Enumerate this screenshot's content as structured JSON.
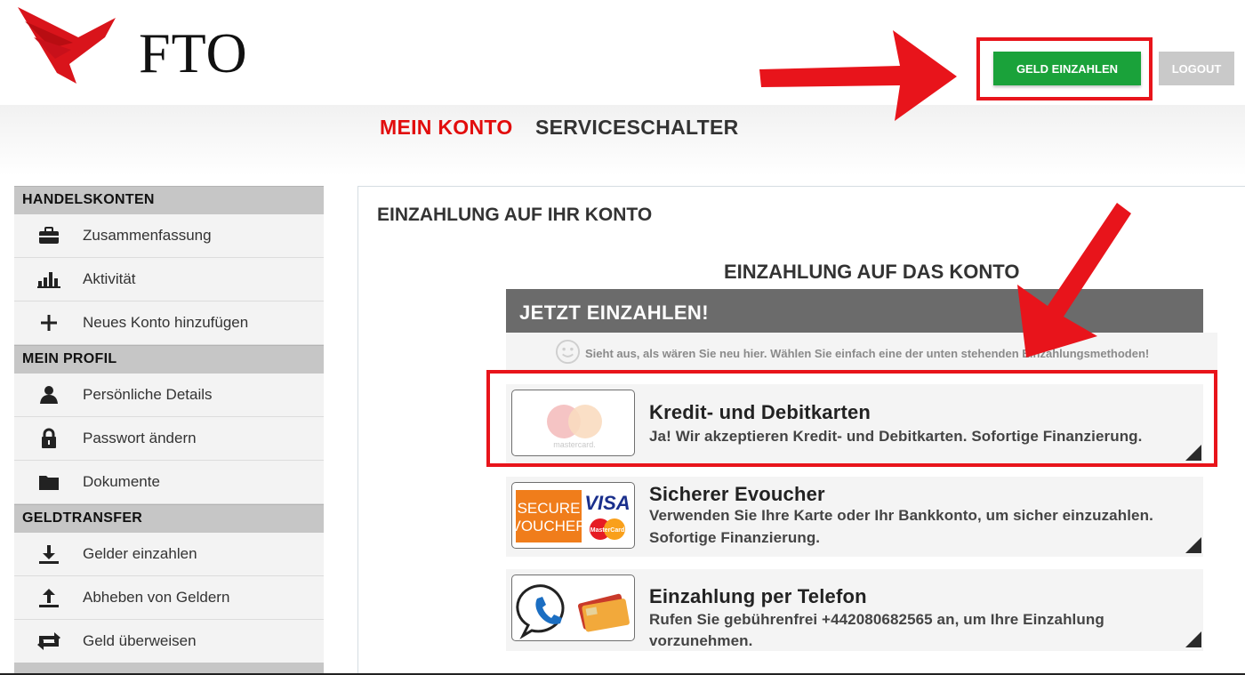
{
  "header": {
    "logo_text": "FTO",
    "deposit_button": "GELD EINZAHLEN",
    "logout_button": "LOGOUT"
  },
  "nav": {
    "items": [
      {
        "label": "MEIN KONTO",
        "active": true
      },
      {
        "label": "SERVICESCHALTER",
        "active": false
      }
    ]
  },
  "sidebar": {
    "sections": [
      {
        "title": "HANDELSKONTEN",
        "items": [
          {
            "label": "Zusammenfassung",
            "icon": "briefcase-icon"
          },
          {
            "label": "Aktivität",
            "icon": "bar-chart-icon"
          },
          {
            "label": "Neues Konto hinzufügen",
            "icon": "plus-icon"
          }
        ]
      },
      {
        "title": "MEIN PROFIL",
        "items": [
          {
            "label": "Persönliche Details",
            "icon": "user-icon"
          },
          {
            "label": "Passwort ändern",
            "icon": "lock-icon"
          },
          {
            "label": "Dokumente",
            "icon": "folder-icon"
          }
        ]
      },
      {
        "title": "GELDTRANSFER",
        "items": [
          {
            "label": "Gelder einzahlen",
            "icon": "download-icon"
          },
          {
            "label": "Abheben von Geldern",
            "icon": "upload-icon"
          },
          {
            "label": "Geld überweisen",
            "icon": "transfer-icon"
          }
        ]
      }
    ]
  },
  "main": {
    "title": "EINZAHLUNG AUF IHR KONTO",
    "subtitle": "EINZAHLUNG AUF DAS KONTO",
    "banner": "JETZT EINZAHLEN!",
    "hint": "Sieht aus, als wären Sie neu hier. Wählen Sie einfach eine der unten stehenden Einzahlungsmethoden!",
    "methods": [
      {
        "title": "Kredit- und Debitkarten",
        "desc": [
          "Ja! Wir akzeptieren Kredit- und Debitkarten. Sofortige Finanzierung."
        ],
        "logo_text": "mastercard."
      },
      {
        "title": "Sicherer Evoucher",
        "desc": [
          "Verwenden Sie Ihre Karte oder Ihr Bankkonto, um sicher einzuzahlen.",
          "Sofortige Finanzierung."
        ],
        "logo_text": [
          "SECURE",
          "VOUCHER",
          "VISA",
          "MasterCard"
        ]
      },
      {
        "title": "Einzahlung per Telefon",
        "desc": [
          "Rufen Sie gebührenfrei +442080682565 an, um Ihre Einzahlung",
          "vorzunehmen."
        ]
      }
    ]
  },
  "colors": {
    "accent_red": "#e20d0d",
    "deposit_green": "#1aa23a",
    "banner_gray": "#6b6b6b"
  }
}
